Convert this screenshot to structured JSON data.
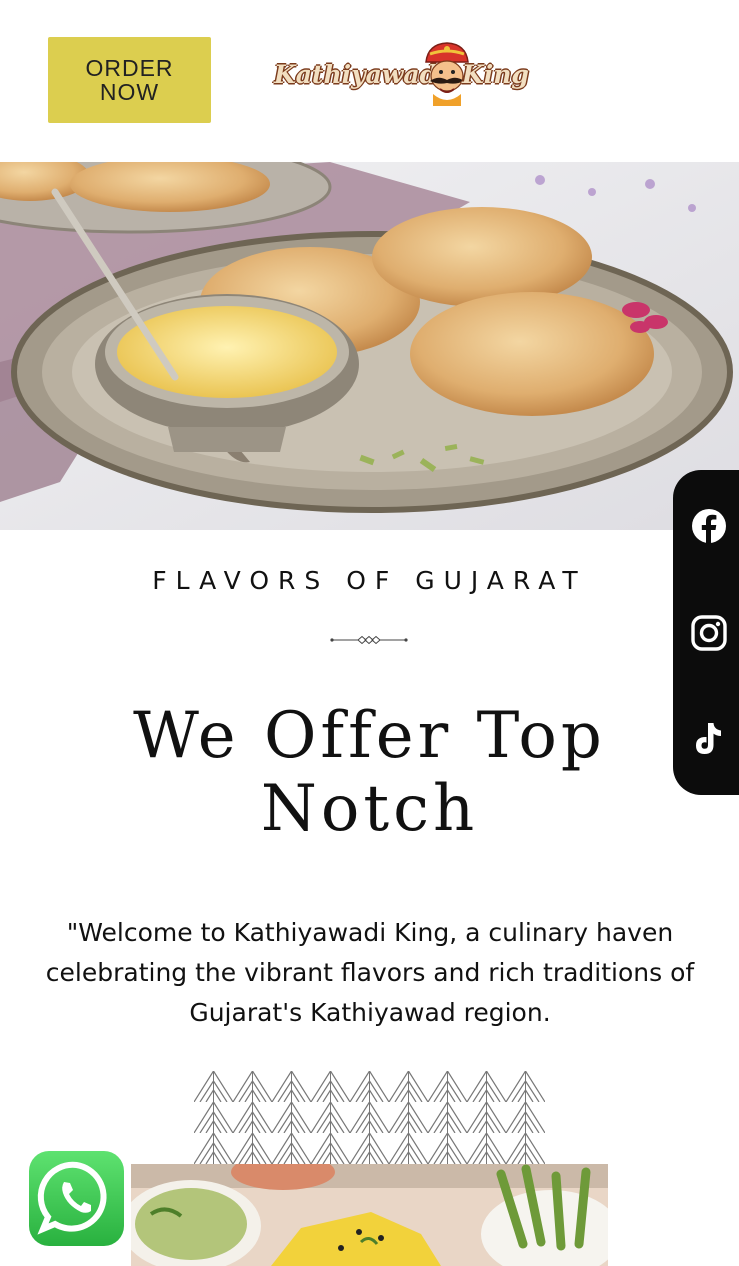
{
  "header": {
    "order_button_label": "ORDER\nNOW",
    "logo": {
      "text_left": "Kathiyawadi",
      "text_right": "King"
    }
  },
  "hero": {
    "image": "puri-shrikhand-platter"
  },
  "social": {
    "items": [
      "facebook-icon",
      "instagram-icon",
      "tiktok-icon"
    ]
  },
  "main": {
    "eyebrow": "FLAVORS OF GUJARAT",
    "headline": "We Offer Top Notch",
    "intro": "\"Welcome to Kathiyawadi King, a culinary haven celebrating the vibrant flavors and rich traditions of Gujarat's Kathiyawad region."
  },
  "colors": {
    "order_button": "#dcce4f",
    "social_bar": "#0c0c0c",
    "whatsapp": "#3fcf58"
  },
  "floating": {
    "whatsapp": "whatsapp-icon"
  }
}
